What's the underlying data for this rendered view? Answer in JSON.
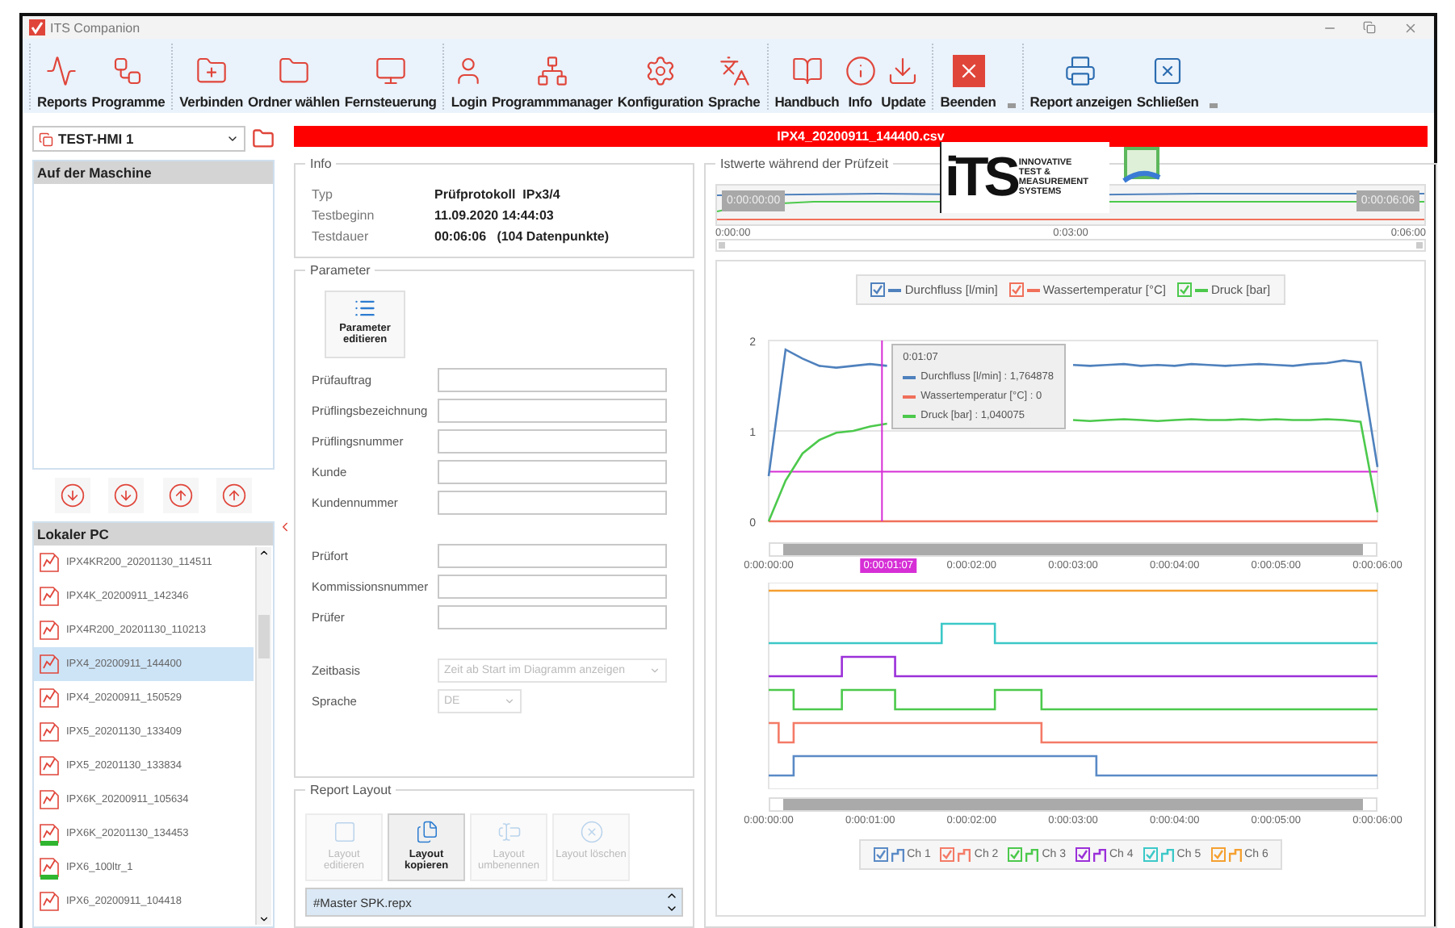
{
  "window": {
    "title": "ITS Companion"
  },
  "toolbar": {
    "groups": [
      {
        "expander": false,
        "items": [
          {
            "label": "Reports"
          },
          {
            "label": "Programme"
          }
        ]
      },
      {
        "expander": false,
        "items": [
          {
            "label": "Verbinden"
          },
          {
            "label": "Ordner wählen"
          },
          {
            "label": "Fernsteuerung"
          }
        ]
      },
      {
        "expander": false,
        "items": [
          {
            "label": "Login"
          },
          {
            "label": "Programmmanager"
          },
          {
            "label": "Konfiguration"
          },
          {
            "label": "Sprache"
          }
        ]
      },
      {
        "expander": false,
        "items": [
          {
            "label": "Handbuch"
          },
          {
            "label": "Info"
          },
          {
            "label": "Update"
          }
        ]
      },
      {
        "expander": true,
        "items": [
          {
            "label": "Beenden"
          }
        ]
      },
      {
        "expander": true,
        "items": [
          {
            "label": "Report anzeigen"
          },
          {
            "label": "Schließen"
          }
        ]
      }
    ]
  },
  "machine": {
    "device": "TEST-HMI 1",
    "list_title": "Auf der Maschine"
  },
  "local": {
    "title": "Lokaler PC",
    "files": [
      {
        "name": "IPX4KR200_20201130_114511",
        "selected": false,
        "flagged": false
      },
      {
        "name": "IPX4K_20200911_142346",
        "selected": false,
        "flagged": false
      },
      {
        "name": "IPX4R200_20201130_110213",
        "selected": false,
        "flagged": false
      },
      {
        "name": "IPX4_20200911_144400",
        "selected": true,
        "flagged": false
      },
      {
        "name": "IPX4_20200911_150529",
        "selected": false,
        "flagged": false
      },
      {
        "name": "IPX5_20201130_133409",
        "selected": false,
        "flagged": false
      },
      {
        "name": "IPX5_20201130_133834",
        "selected": false,
        "flagged": false
      },
      {
        "name": "IPX6K_20200911_105634",
        "selected": false,
        "flagged": false
      },
      {
        "name": "IPX6K_20201130_134453",
        "selected": false,
        "flagged": true
      },
      {
        "name": "IPX6_100ltr_1",
        "selected": false,
        "flagged": true
      },
      {
        "name": "IPX6_20200911_104418",
        "selected": false,
        "flagged": false
      }
    ]
  },
  "file_title": "IPX4_20200911_144400.csv",
  "info": {
    "title": "Info",
    "rows": [
      {
        "label": "Typ",
        "value": "Prüfprotokoll  IPx3/4"
      },
      {
        "label": "Testbeginn",
        "value": "11.09.2020 14:44:03"
      },
      {
        "label": "Testdauer",
        "value": "00:06:06   (104 Datenpunkte)"
      }
    ]
  },
  "parameter": {
    "title": "Parameter",
    "edit_button": "Parameter editieren",
    "field_groups": [
      [
        {
          "label": "Prüfauftrag"
        },
        {
          "label": "Prüflingsbezeichnung"
        },
        {
          "label": "Prüflingsnummer"
        },
        {
          "label": "Kunde"
        },
        {
          "label": "Kundennummer"
        }
      ],
      [
        {
          "label": "Prüfort"
        },
        {
          "label": "Kommissionsnummer"
        },
        {
          "label": "Prüfer"
        }
      ]
    ],
    "selects": [
      {
        "label": "Zeitbasis",
        "value": "Zeit ab Start im Diagramm anzeigen",
        "disabled": true,
        "kind": "wide"
      },
      {
        "label": "Sprache",
        "value": "DE",
        "disabled": true,
        "kind": "narrow"
      }
    ]
  },
  "report_layout": {
    "title": "Report Layout",
    "buttons": [
      {
        "label": "Layout editieren",
        "disabled": true
      },
      {
        "label": "Layout kopieren",
        "disabled": false
      },
      {
        "label": "Layout umbenennen",
        "disabled": true
      },
      {
        "label": "Layout löschen",
        "disabled": true
      }
    ],
    "layouts": [
      {
        "name": "#Master SPK.repx",
        "selected": true
      }
    ]
  },
  "measurements": {
    "title": "Istwerte während der Prüfzeit",
    "overview": {
      "start": "0:00:00:00",
      "end": "0:00:06:06",
      "ticks": [
        "0:00:00",
        "0:03:00",
        "0:06:00"
      ]
    },
    "logo": {
      "mark": "iTS",
      "lines": [
        "INNOVATIVE",
        "TEST &",
        "MEASUREMENT",
        "SYSTEMS"
      ]
    },
    "legend": [
      {
        "checked": true
      },
      {
        "checked": true
      },
      {
        "checked": true
      }
    ],
    "chart_data": {
      "type": "line",
      "categories": [
        "0:00:00:00",
        null,
        null,
        null,
        null,
        null,
        null,
        null,
        null,
        null,
        null,
        null,
        "0:00:02:00",
        null,
        null,
        null,
        null,
        null,
        "0:00:03:00",
        null,
        null,
        null,
        null,
        null,
        "0:00:04:00",
        null,
        null,
        null,
        null,
        null,
        "0:00:05:00",
        null,
        null,
        null,
        null,
        null,
        "0:00:06:00"
      ],
      "ylim": [
        0,
        2
      ],
      "yticks": [
        0,
        1,
        2
      ],
      "series": [
        {
          "name": "Durchfluss [l/min]",
          "color": "#4f81bd",
          "values": [
            0.5,
            1.9,
            1.8,
            1.72,
            1.7,
            1.72,
            1.74,
            1.72,
            null,
            null,
            null,
            null,
            null,
            null,
            null,
            null,
            null,
            null,
            1.73,
            1.72,
            1.73,
            1.74,
            1.72,
            1.73,
            1.72,
            1.74,
            1.73,
            1.72,
            1.73,
            1.74,
            1.73,
            1.72,
            1.74,
            1.75,
            1.78,
            1.76,
            0.6
          ]
        },
        {
          "name": "Wassertemperatur [°C]",
          "color": "#f0705a",
          "values": [
            0,
            0,
            0,
            0,
            0,
            0,
            0,
            0,
            0,
            0,
            0,
            0,
            0,
            0,
            0,
            0,
            0,
            0,
            0,
            0,
            0,
            0,
            0,
            0,
            0,
            0,
            0,
            0,
            0,
            0,
            0,
            0,
            0,
            0,
            0,
            0,
            0
          ]
        },
        {
          "name": "Druck [bar]",
          "color": "#4cc94c",
          "values": [
            0,
            0.45,
            0.75,
            0.9,
            0.98,
            1.0,
            1.05,
            1.08,
            null,
            null,
            null,
            null,
            null,
            null,
            null,
            null,
            null,
            null,
            1.12,
            1.11,
            1.12,
            1.13,
            1.12,
            1.11,
            1.12,
            1.13,
            1.12,
            1.12,
            1.13,
            1.12,
            1.13,
            1.12,
            1.12,
            1.13,
            1.12,
            1.1,
            0.1
          ]
        }
      ],
      "ref_lines": [
        {
          "axis": "y",
          "value": 1,
          "color": "#e4e4e4"
        },
        {
          "axis": "y",
          "value": 0.55,
          "color": "#d62fd6"
        }
      ]
    },
    "tooltip": {
      "time": "0:01:07",
      "rows": [
        "Durchfluss [l/min] : 1,764878",
        "Wassertemperatur [°C] : 0",
        "Druck [bar] : 1,040075"
      ]
    },
    "cursor_label": "0:00:01:07",
    "channels": {
      "ticks": [
        "0:00:00:00",
        "0:00:01:00",
        "0:00:02:00",
        "0:00:03:00",
        "0:00:04:00",
        "0:00:05:00",
        "0:00:06:00"
      ],
      "legend": [
        {
          "label": "Ch 1",
          "color": "#5a8ac6",
          "checked": true
        },
        {
          "label": "Ch 2",
          "color": "#f47b67",
          "checked": true
        },
        {
          "label": "Ch 3",
          "color": "#4cc94c",
          "checked": true
        },
        {
          "label": "Ch 4",
          "color": "#9b30d9",
          "checked": true
        },
        {
          "label": "Ch 5",
          "color": "#3cc8c8",
          "checked": true
        },
        {
          "label": "Ch 6",
          "color": "#f5a030",
          "checked": true
        }
      ]
    }
  }
}
